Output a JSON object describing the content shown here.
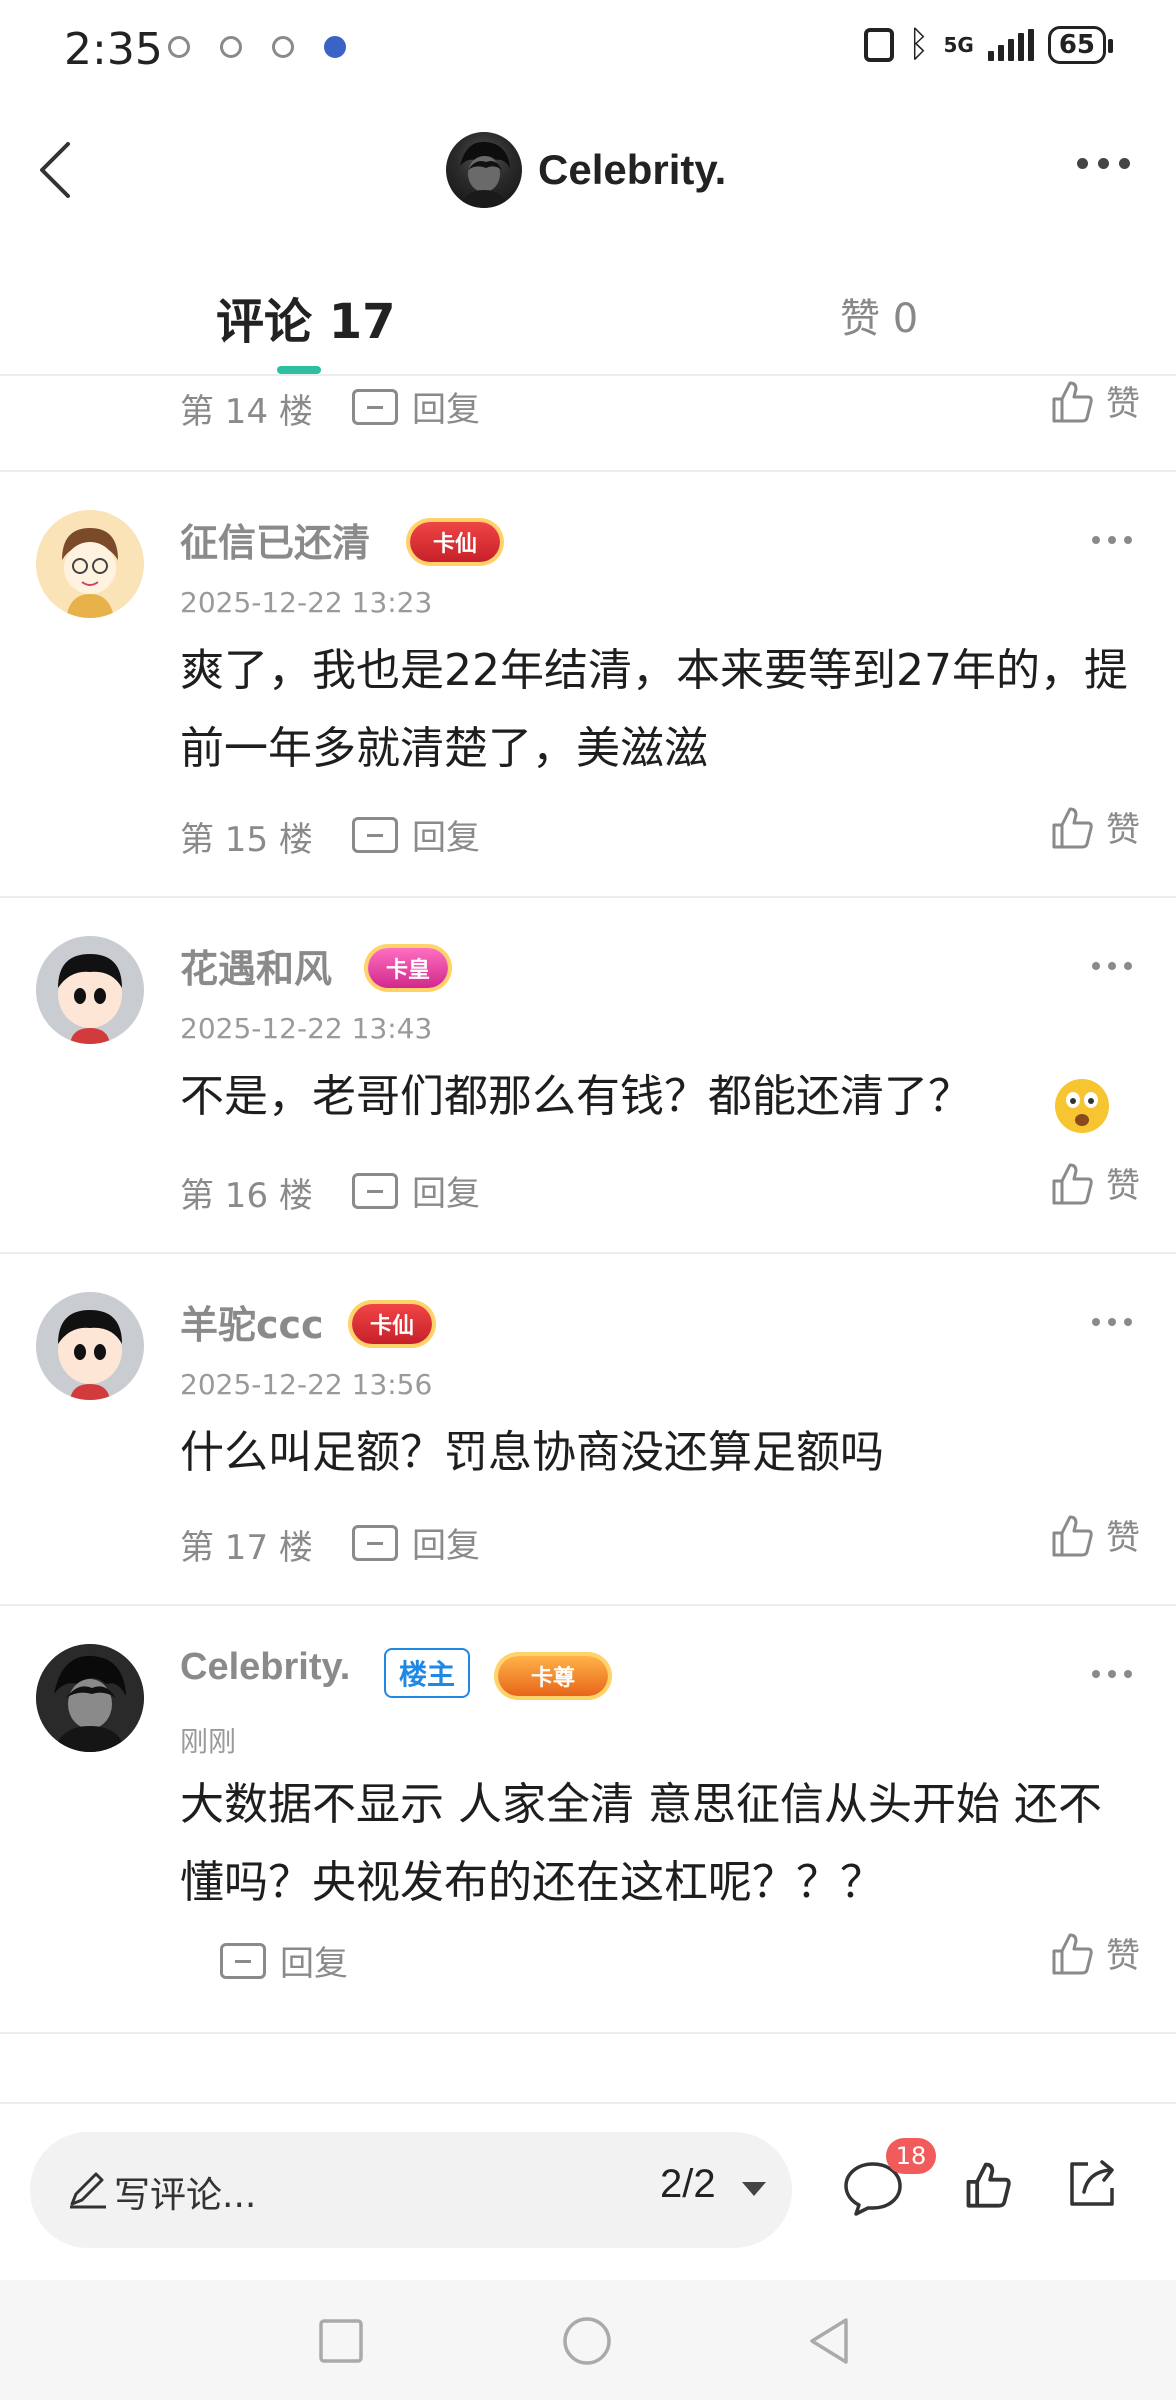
{
  "status_bar": {
    "time": "2:35",
    "network": "5G",
    "battery": "65"
  },
  "header": {
    "title": "Celebrity."
  },
  "tabs": {
    "comments": "评论 17",
    "likes": "赞 0"
  },
  "top_partial": {
    "floor": "第 14 楼",
    "reply": "回复",
    "like": "赞"
  },
  "comments": [
    {
      "username": "征信已还清",
      "badge": "卡仙",
      "time": "2025-12-22 13:23",
      "text": "爽了，我也是22年结清，本来要等到27年的，提前一年多就清楚了，美滋滋",
      "floor": "第 15 楼",
      "reply": "回复",
      "like": "赞"
    },
    {
      "username": "花遇和风",
      "badge": "卡皇",
      "time": "2025-12-22 13:43",
      "text": "不是，老哥们都那么有钱？都能还清了？",
      "floor": "第 16 楼",
      "reply": "回复",
      "like": "赞"
    },
    {
      "username": "羊驼ccc",
      "badge": "卡仙",
      "time": "2025-12-22 13:56",
      "text": "什么叫足额？罚息协商没还算足额吗",
      "floor": "第 17 楼",
      "reply": "回复",
      "like": "赞"
    },
    {
      "username": "Celebrity.",
      "owner_tag": "楼主",
      "badge": "卡尊",
      "time": "刚刚",
      "text": "大数据不显示 人家全清 意思征信从头开始 还不懂吗？央视发布的还在这杠呢？？？",
      "reply": "回复",
      "like": "赞"
    }
  ],
  "bottom_bar": {
    "placeholder": "写评论...",
    "page": "2/2",
    "comment_count": "18"
  },
  "colors": {
    "accent": "#2dbfa0",
    "badge_red": "#f25b5b",
    "owner_tag": "#1e88e5"
  }
}
